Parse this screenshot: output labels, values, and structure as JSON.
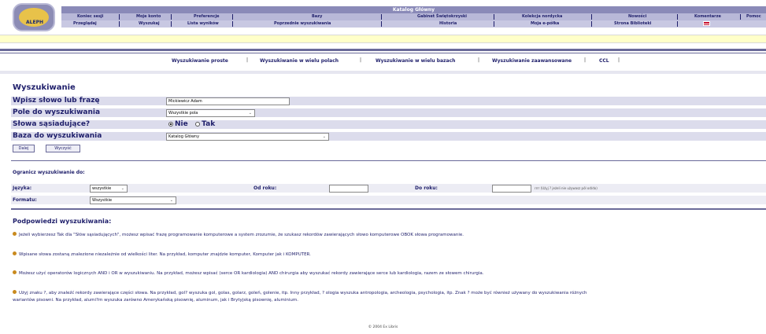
{
  "header": {
    "logo_text": "ALEPH",
    "catalog_title": "Katalog Główny",
    "menu_row1": [
      "Koniec sesji",
      "Moje konto",
      "Preferencje",
      "Bazy",
      "Gabinet Świętokrzyski",
      "Kolekcja nordycka",
      "Nowości",
      "Komentarze",
      "Pomoc"
    ],
    "menu_row2": [
      "Przeglądaj",
      "Wyszukaj",
      "Lista wyników",
      "Poprzednie wyszukiwania",
      "Historia",
      "Moja e-półka",
      "Strona Biblioteki"
    ],
    "flag_icon": "uk-flag-icon"
  },
  "search_tabs": [
    "Wyszukiwanie proste",
    "Wyszukiwanie w wielu polach",
    "Wyszukiwanie w wielu bazach",
    "Wyszukiwanie zaawansowane",
    "CCL"
  ],
  "form": {
    "title": "Wyszukiwanie",
    "phrase_label": "Wpisz słowo lub frazę",
    "phrase_value": "Mickiewicz Adam",
    "field_label": "Pole do wyszukiwania",
    "field_value": "Wszystkie pola",
    "adjacent_label": "Słowa sąsiadujące?",
    "adjacent_no": "Nie",
    "adjacent_yes": "Tak",
    "adjacent_selected": "Nie",
    "base_label": "Baza do wyszukiwania",
    "base_value": "Katalog Główny",
    "submit_label": "Dalej",
    "clear_label": "Wyczyść"
  },
  "restrict": {
    "title": "Ogranicz wyszukiwanie do:",
    "language_label": "Języka:",
    "language_value": "wszystkie",
    "format_label": "Formatu:",
    "format_value": "Wszystkie",
    "from_year_label": "Od roku:",
    "from_year_value": "",
    "to_year_label": "Do roku:",
    "to_year_value": "",
    "year_hint": "rrrr (Użyj ? jeżeli nie używasz pól od/do)"
  },
  "hints": {
    "title": "Podpowiedzi wyszukiwania:",
    "items": [
      "Jeżeli wybierzesz Tak dla \"Słów sąsiadujących\", możesz wpisać frazę programowanie komputerowe a system zrozumie, że szukasz rekordów zawierających słowo komputerowe OBOK słowa programowanie.",
      "Wpisane słowa zostaną znalezione niezależnie od wielkości liter. Na przykład, komputer znajdzie komputer, Komputer jak i KOMPUTER.",
      "Możesz użyć operatorów logicznych AND i OR w wyszukiwaniu. Na przykład, możesz wpisać (serce OR kardiologia) AND chirurgia aby wyszukać rekordy zawierające serce lub kardiologia, razem ze słowem chirurgia.",
      "Użyj znaku ?, aby znaleźć rekordy zawierające części słowa. Na przykład, gol? wyszuka gol, golas, golarz, goleń, golenie, itp. Inny przykład, ? ologia wyszuka antropologia, archeologia, psychologia, itp. Znak ? może być również używany do wyszukiwania różnych",
      "wariantów pisowni. Na przykład, alumi?m wyszuka zarówno Amerykańską pisownię, aluminum, jak i Brytyjską pisownię, aluminium."
    ]
  },
  "footer": "© 2004 Ex Libris",
  "colors": {
    "accent": "#1f1f6b",
    "topbar": "#8a8ab8",
    "highlight": "#ffffc9"
  }
}
